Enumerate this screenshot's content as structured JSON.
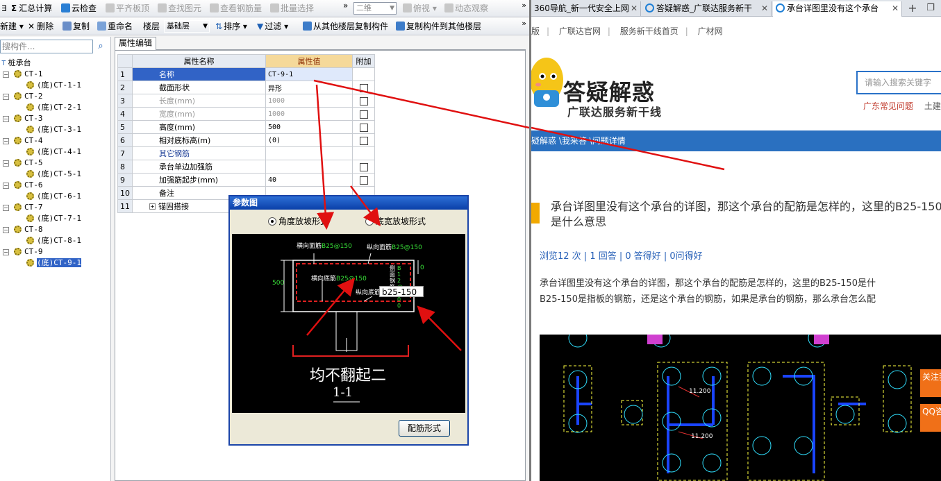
{
  "toolbar1": {
    "items": [
      "汇总计算",
      "云检查",
      "平齐板顶",
      "查找图元",
      "查看钢筋量",
      "批量选择"
    ],
    "view_mode": "二维",
    "view_dir": "俯视",
    "orbit": "动态观察"
  },
  "toolbar2": {
    "new": "新建",
    "delete": "删除",
    "copy": "复制",
    "rename": "重命名",
    "floor_label": "楼层",
    "floor_value": "基础层",
    "sort": "排序",
    "filter": "过滤",
    "copy_from": "从其他楼层复制构件",
    "copy_to": "复制构件到其他楼层"
  },
  "tree": {
    "search_placeholder": "搜构件...",
    "root": "桩承台",
    "nodes": [
      {
        "parent": "CT-1",
        "child": "(底)CT-1-1"
      },
      {
        "parent": "CT-2",
        "child": "(底)CT-2-1"
      },
      {
        "parent": "CT-3",
        "child": "(底)CT-3-1"
      },
      {
        "parent": "CT-4",
        "child": "(底)CT-4-1"
      },
      {
        "parent": "CT-5",
        "child": "(底)CT-5-1"
      },
      {
        "parent": "CT-6",
        "child": "(底)CT-6-1"
      },
      {
        "parent": "CT-7",
        "child": "(底)CT-7-1"
      },
      {
        "parent": "CT-8",
        "child": "(底)CT-8-1"
      },
      {
        "parent": "CT-9",
        "child": "(底)CT-9-1"
      }
    ]
  },
  "props": {
    "tab": "属性编辑",
    "headers": [
      "属性名称",
      "属性值",
      "附加"
    ],
    "rows": [
      {
        "no": "1",
        "name": "名称",
        "value": "CT-9-1"
      },
      {
        "no": "2",
        "name": "截面形状",
        "value": "异形"
      },
      {
        "no": "3",
        "name": "长度(mm)",
        "value": "1000"
      },
      {
        "no": "4",
        "name": "宽度(mm)",
        "value": "1000"
      },
      {
        "no": "5",
        "name": "高度(mm)",
        "value": "500"
      },
      {
        "no": "6",
        "name": "相对底标高(m)",
        "value": "(0)"
      },
      {
        "no": "7",
        "name": "其它钢筋",
        "value": ""
      },
      {
        "no": "8",
        "name": "承台单边加强筋",
        "value": ""
      },
      {
        "no": "9",
        "name": "加强筋起步(mm)",
        "value": "40"
      },
      {
        "no": "10",
        "name": "备注",
        "value": ""
      },
      {
        "no": "11",
        "name": "锚固搭接",
        "value": ""
      }
    ]
  },
  "dialog": {
    "title": "参数图",
    "radio1": "角度放坡形式",
    "radio2": "底宽放坡形式",
    "labels": {
      "top_h": "横向面筋",
      "top_h_val": "B25@150",
      "top_v": "纵向面筋",
      "top_v_val": "B25@150",
      "bot_h": "横向底筋",
      "bot_h_val": "B25@150",
      "bot_v": "纵向底筋",
      "side": "侧面钢筋",
      "side_val": "B12@200",
      "height": "500",
      "zero": "0",
      "input": "b25-150",
      "note": "均不翻起二",
      "section": "1-1"
    },
    "button": "配筋形式"
  },
  "browser": {
    "tabs": [
      "360导航_新一代安全上网",
      "答疑解惑_广联达服务新干",
      "承台详图里没有这个承台"
    ],
    "nav_links": [
      "版",
      "广联达官网",
      "服务新干线首页",
      "广材网"
    ],
    "logo_title": "答疑解惑",
    "logo_sub": "广联达服务新干线",
    "search_placeholder": "请输入搜索关键字",
    "hot_links": [
      "广东常见问题",
      "土建"
    ],
    "breadcrumb": "疑解惑 \\我来答 \\问题详情",
    "question_title": "承台详图里没有这个承台的详图，那这个承台的配筋是怎样的，这里的B25-150是什么意思",
    "stats": "浏览12 次 | 1 回答 | 0 答得好 | 0问得好",
    "body_line1": "承台详图里没有这个承台的详图，那这个承台的配筋是怎样的，这里的B25-150是什",
    "body_line2": "B25-150是指板的钢筋，还是这个承台的钢筋，如果是承台的钢筋，那么承台怎么配",
    "side_follow": "关注我们",
    "side_qq": "QQ咨询",
    "cad_labels": [
      "11.200",
      "11.200"
    ]
  }
}
